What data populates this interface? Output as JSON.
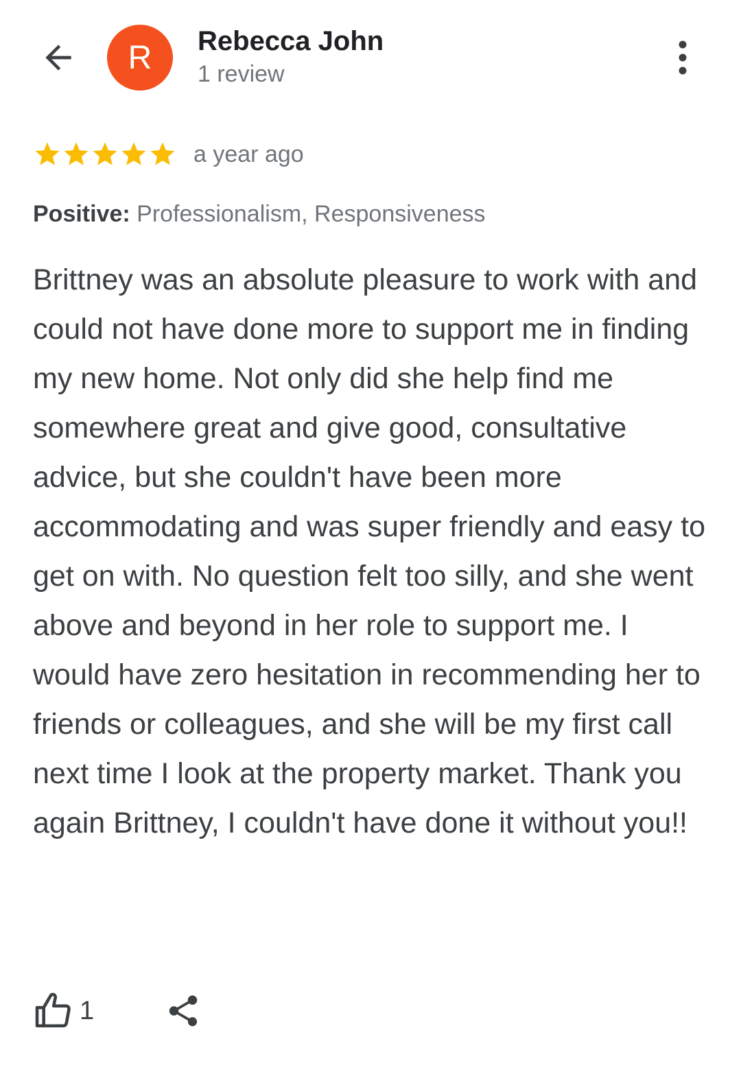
{
  "header": {
    "avatar_letter": "R",
    "avatar_color": "#f4511e",
    "reviewer_name": "Rebecca John",
    "review_count": "1 review",
    "back_icon": "arrow-left-icon",
    "more_icon": "more-vertical-icon"
  },
  "review": {
    "rating": 5,
    "max_rating": 5,
    "star_color": "#fbbc04",
    "time": "a year ago",
    "positive_label": "Positive:",
    "positive_value": "Professionalism, Responsiveness",
    "text": "Brittney was an absolute pleasure to work with and could not have done more to support me in finding my new home. Not only did she help find me somewhere great and give good, consultative advice, but she couldn't have been more accommodating and was super friendly and easy to get on with. No question felt too silly, and she went above and beyond in her role to support me. I would have zero hesitation in recommending her to friends or colleagues, and she will be my first call next time I look at the property market. Thank you again Brittney, I couldn't have done it without you!!"
  },
  "actions": {
    "like_icon": "thumbs-up-icon",
    "like_count": "1",
    "share_icon": "share-icon"
  }
}
